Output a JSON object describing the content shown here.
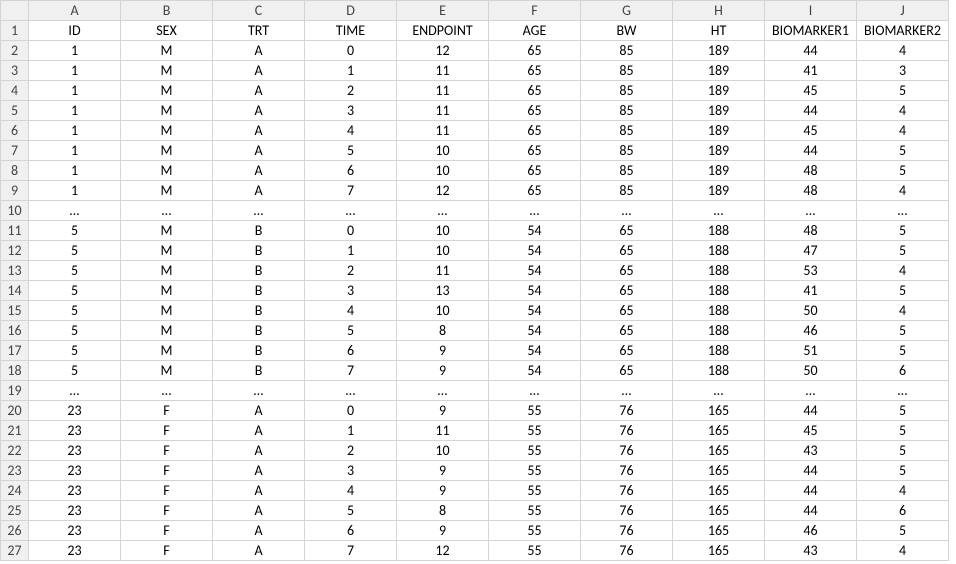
{
  "columns": [
    "A",
    "B",
    "C",
    "D",
    "E",
    "F",
    "G",
    "H",
    "I",
    "J"
  ],
  "rowNumbers": [
    1,
    2,
    3,
    4,
    5,
    6,
    7,
    8,
    9,
    10,
    11,
    12,
    13,
    14,
    15,
    16,
    17,
    18,
    19,
    20,
    21,
    22,
    23,
    24,
    25,
    26,
    27
  ],
  "headers": [
    "ID",
    "SEX",
    "TRT",
    "TIME",
    "ENDPOINT",
    "AGE",
    "BW",
    "HT",
    "BIOMARKER1",
    "BIOMARKER2"
  ],
  "rows": [
    [
      "1",
      "M",
      "A",
      "0",
      "12",
      "65",
      "85",
      "189",
      "44",
      "4"
    ],
    [
      "1",
      "M",
      "A",
      "1",
      "11",
      "65",
      "85",
      "189",
      "41",
      "3"
    ],
    [
      "1",
      "M",
      "A",
      "2",
      "11",
      "65",
      "85",
      "189",
      "45",
      "5"
    ],
    [
      "1",
      "M",
      "A",
      "3",
      "11",
      "65",
      "85",
      "189",
      "44",
      "4"
    ],
    [
      "1",
      "M",
      "A",
      "4",
      "11",
      "65",
      "85",
      "189",
      "45",
      "4"
    ],
    [
      "1",
      "M",
      "A",
      "5",
      "10",
      "65",
      "85",
      "189",
      "44",
      "5"
    ],
    [
      "1",
      "M",
      "A",
      "6",
      "10",
      "65",
      "85",
      "189",
      "48",
      "5"
    ],
    [
      "1",
      "M",
      "A",
      "7",
      "12",
      "65",
      "85",
      "189",
      "48",
      "4"
    ],
    [
      "…",
      "…",
      "…",
      "…",
      "…",
      "…",
      "…",
      "…",
      "…",
      "…"
    ],
    [
      "5",
      "M",
      "B",
      "0",
      "10",
      "54",
      "65",
      "188",
      "48",
      "5"
    ],
    [
      "5",
      "M",
      "B",
      "1",
      "10",
      "54",
      "65",
      "188",
      "47",
      "5"
    ],
    [
      "5",
      "M",
      "B",
      "2",
      "11",
      "54",
      "65",
      "188",
      "53",
      "4"
    ],
    [
      "5",
      "M",
      "B",
      "3",
      "13",
      "54",
      "65",
      "188",
      "41",
      "5"
    ],
    [
      "5",
      "M",
      "B",
      "4",
      "10",
      "54",
      "65",
      "188",
      "50",
      "4"
    ],
    [
      "5",
      "M",
      "B",
      "5",
      "8",
      "54",
      "65",
      "188",
      "46",
      "5"
    ],
    [
      "5",
      "M",
      "B",
      "6",
      "9",
      "54",
      "65",
      "188",
      "51",
      "5"
    ],
    [
      "5",
      "M",
      "B",
      "7",
      "9",
      "54",
      "65",
      "188",
      "50",
      "6"
    ],
    [
      "…",
      "…",
      "…",
      "…",
      "…",
      "…",
      "…",
      "…",
      "…",
      "…"
    ],
    [
      "23",
      "F",
      "A",
      "0",
      "9",
      "55",
      "76",
      "165",
      "44",
      "5"
    ],
    [
      "23",
      "F",
      "A",
      "1",
      "11",
      "55",
      "76",
      "165",
      "45",
      "5"
    ],
    [
      "23",
      "F",
      "A",
      "2",
      "10",
      "55",
      "76",
      "165",
      "43",
      "5"
    ],
    [
      "23",
      "F",
      "A",
      "3",
      "9",
      "55",
      "76",
      "165",
      "44",
      "5"
    ],
    [
      "23",
      "F",
      "A",
      "4",
      "9",
      "55",
      "76",
      "165",
      "44",
      "4"
    ],
    [
      "23",
      "F",
      "A",
      "5",
      "8",
      "55",
      "76",
      "165",
      "44",
      "6"
    ],
    [
      "23",
      "F",
      "A",
      "6",
      "9",
      "55",
      "76",
      "165",
      "46",
      "5"
    ],
    [
      "23",
      "F",
      "A",
      "7",
      "12",
      "55",
      "76",
      "165",
      "43",
      "4"
    ]
  ]
}
